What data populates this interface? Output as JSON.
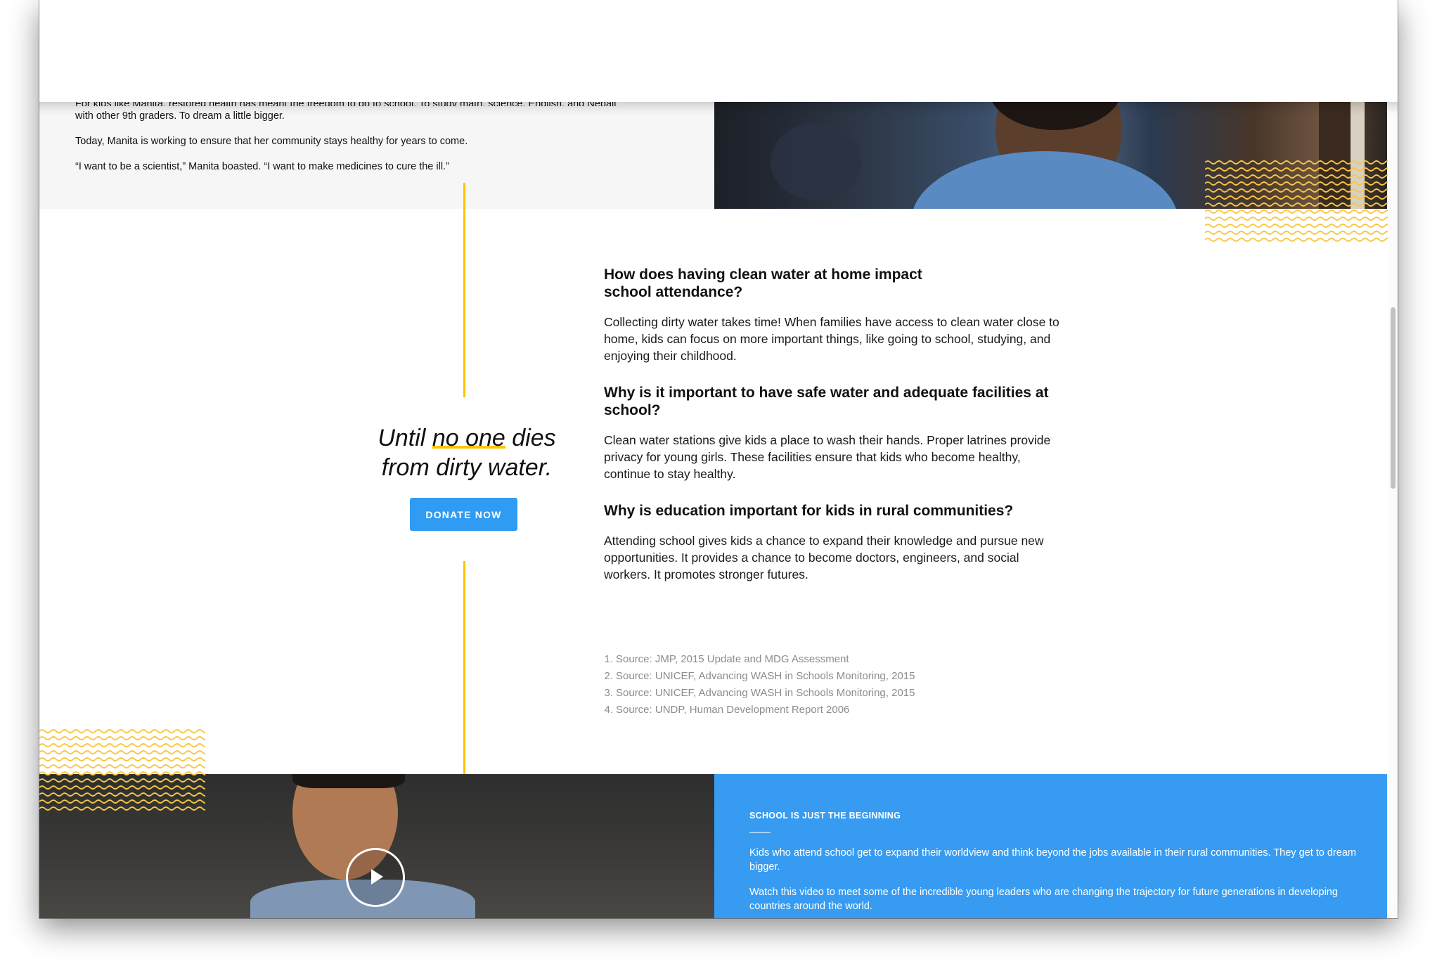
{
  "story": {
    "p0": "For kids like Manita, restored health has meant the freedom to go to school. To study math, science, English, and Nepali",
    "p1": "with other 9th graders. To dream a little bigger.",
    "p2": "Today, Manita is working to ensure that her community stays healthy for years to come.",
    "p3": "“I want to be a scientist,” Manita boasted. “I want to make medicines to cure the ill.”"
  },
  "cta": {
    "line1_before": "Until ",
    "line1_highlight": "no one",
    "line1_after": " dies",
    "line2": "from dirty water.",
    "donate_label": "DONATE NOW"
  },
  "faq": [
    {
      "question": "How does having clean water at home impact school attendance?",
      "answer": "Collecting dirty water takes time! When families have access to clean water close to home, kids can focus on more important things, like going to school, studying, and enjoying their childhood."
    },
    {
      "question": "Why is it important to have safe water and adequate facilities at school?",
      "answer": "Clean water stations give kids a place to wash their hands. Proper latrines provide privacy for young girls. These facilities ensure that kids who become healthy, continue to stay healthy."
    },
    {
      "question": "Why is education important for kids in rural communities?",
      "answer": "Attending school gives kids a chance to expand their knowledge and pursue new opportunities. It provides a chance to become doctors, engineers, and social workers. It promotes stronger futures."
    }
  ],
  "sources": [
    {
      "num": "1.",
      "text": "Source: JMP, 2015 Update and MDG Assessment"
    },
    {
      "num": "2.",
      "text": "Source: UNICEF, Advancing WASH in Schools Monitoring, 2015"
    },
    {
      "num": "3.",
      "text": "Source: UNICEF, Advancing WASH in Schools Monitoring, 2015"
    },
    {
      "num": "4.",
      "text": "Source: UNDP, Human Development Report 2006"
    }
  ],
  "video_section": {
    "label": "SCHOOL IS JUST THE BEGINNING",
    "p1": "Kids who attend school get to expand their worldview and think beyond the jobs available in their rural communities. They get to dream bigger.",
    "p2": "Watch this video to meet some of the incredible young leaders who are changing the trajectory for future generations in developing countries around the world.",
    "play_icon": "play-icon"
  },
  "colors": {
    "accent_yellow": "#ffc400",
    "button_blue": "#2f9bf3",
    "panel_blue": "#379cf1",
    "source_gray": "#8c8c8c"
  }
}
